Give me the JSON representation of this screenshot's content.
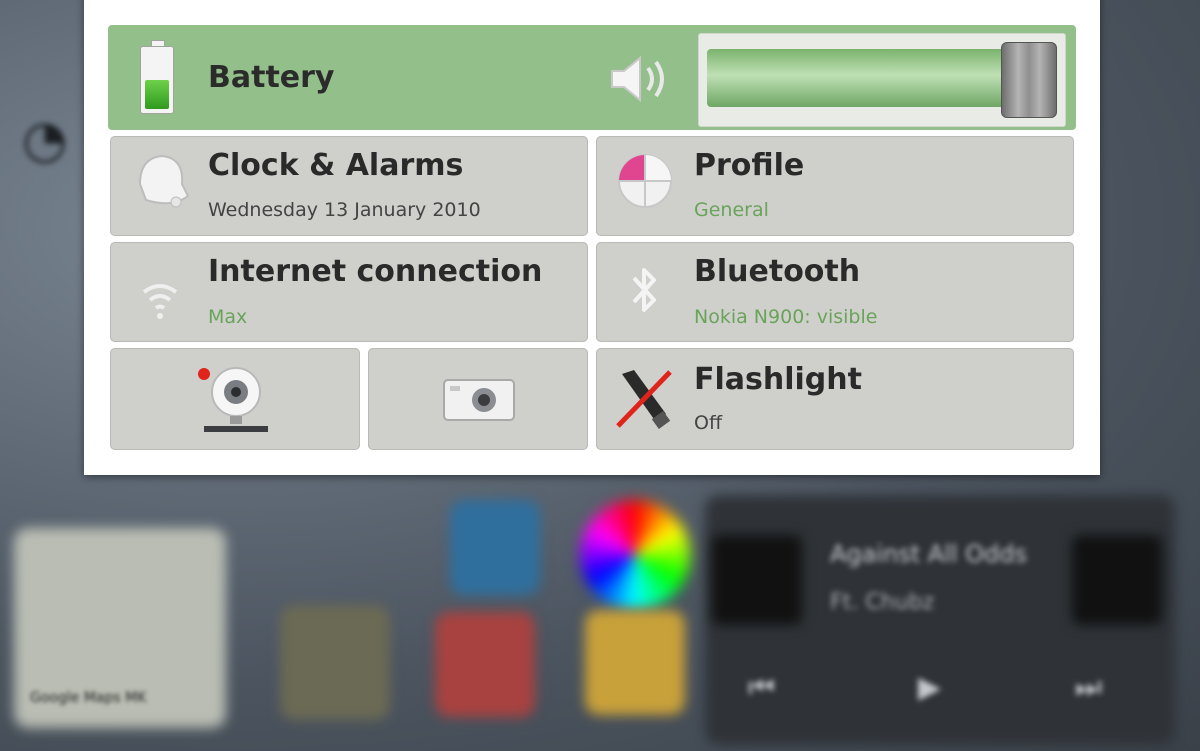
{
  "status_menu": {
    "battery": {
      "label": "Battery",
      "level": 0.5
    },
    "volume": {
      "level": 0.98
    },
    "clock": {
      "title": "Clock & Alarms",
      "subtitle": "Wednesday 13 January 2010"
    },
    "profile": {
      "title": "Profile",
      "subtitle": "General"
    },
    "internet": {
      "title": "Internet connection",
      "subtitle": "Max"
    },
    "bluetooth": {
      "title": "Bluetooth",
      "subtitle": "Nokia N900: visible"
    },
    "flashlight": {
      "title": "Flashlight",
      "subtitle": "Off"
    }
  },
  "background": {
    "map_label": "Google Maps MK",
    "media_line1": "Against All Odds",
    "media_line2": "Ft. Chubz"
  },
  "colors": {
    "battery_row_bg": "#93c08a",
    "tile_bg": "#cfd0cc",
    "subtitle_green": "#6aa35a",
    "profile_accent": "#e0468f"
  },
  "icons": {
    "battery": "battery-icon",
    "speaker": "speaker-icon",
    "clock": "alarm-bell-icon",
    "profile": "profile-pie-icon",
    "internet": "wifi-icon",
    "bluetooth": "bluetooth-icon",
    "webcam": "webcam-icon",
    "camera": "camera-icon",
    "flashlight": "flashlight-off-icon"
  }
}
